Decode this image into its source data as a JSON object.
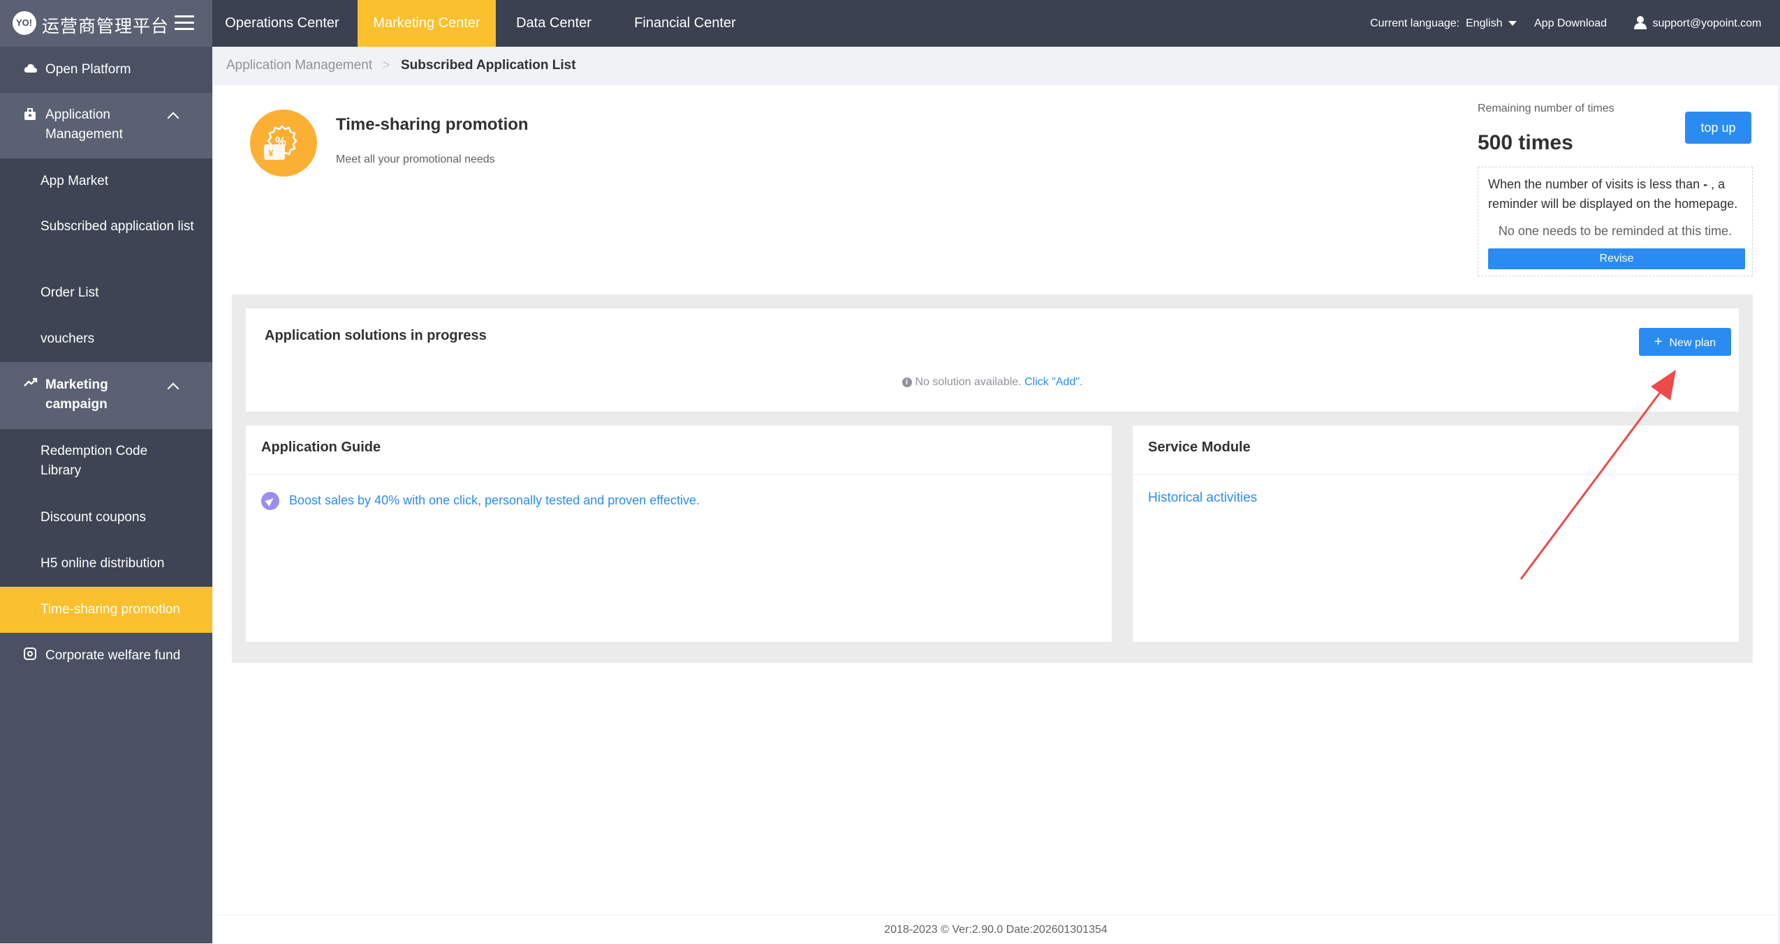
{
  "brand": {
    "logo_mark": "YO!",
    "title": "运营商管理平台"
  },
  "topnav": {
    "tabs": [
      "Operations Center",
      "Marketing Center",
      "Data Center",
      "Financial Center"
    ],
    "active_tab": "Marketing Center",
    "language_label": "Current language:",
    "language_value": "English",
    "app_download": "App Download",
    "user_email": "support@yopoint.com"
  },
  "sidebar": {
    "open_platform": "Open Platform",
    "application_management": "Application Management",
    "app_items": [
      "App Market",
      "Subscribed application list",
      "Order List",
      "vouchers"
    ],
    "marketing_campaign": "Marketing campaign",
    "marketing_items": [
      "Redemption Code Library",
      "Discount coupons",
      "H5 online distribution",
      "Time-sharing promotion"
    ],
    "active_item": "Time-sharing promotion",
    "corporate_welfare": "Corporate welfare fund"
  },
  "breadcrumb": {
    "parent": "Application Management",
    "separator": ">",
    "current": "Subscribed Application List"
  },
  "app_header": {
    "title": "Time-sharing promotion",
    "subtitle": "Meet all your promotional needs"
  },
  "remaining": {
    "label": "Remaining number of times",
    "value": "500 times",
    "top_up": "top up",
    "reminder_prefix": "When the number of visits is less than",
    "reminder_threshold": "-",
    "reminder_suffix": ", a reminder will be displayed on the homepage.",
    "no_remind": "No one needs to be reminded at this time.",
    "revise": "Revise"
  },
  "solutions": {
    "title": "Application solutions in progress",
    "new_plan": "New plan",
    "empty_text": "No solution available.",
    "empty_link": "Click \"Add\"."
  },
  "guide": {
    "title": "Application Guide",
    "link": "Boost sales by 40% with one click, personally tested and proven effective."
  },
  "service": {
    "title": "Service Module",
    "link": "Historical activities"
  },
  "footer": {
    "text": "2018-2023 © Ver:2.90.0 Date:202601301354"
  },
  "colors": {
    "accent": "#2a8cf0",
    "active": "#fbc02d",
    "sidebar": "#4b5162",
    "topnav": "#3b4151",
    "arrow": "#ef4a4a"
  }
}
